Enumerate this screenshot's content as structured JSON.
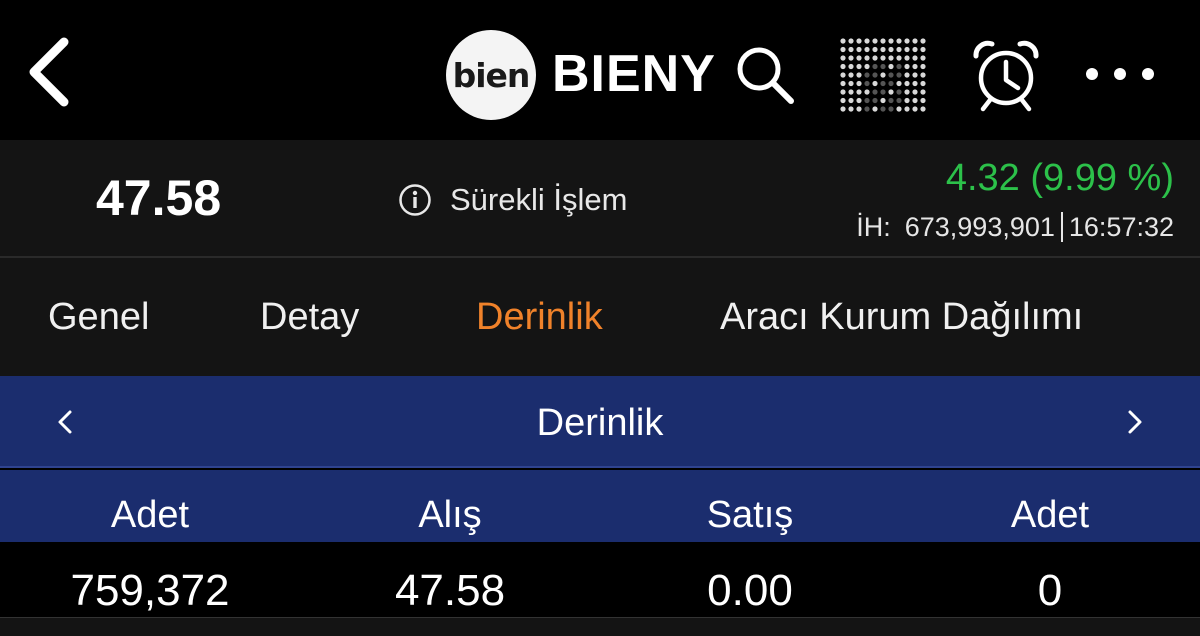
{
  "header": {
    "logo_text": "bien",
    "ticker": "BIENY",
    "icons": {
      "back": "chevron-left-icon",
      "search": "search-icon",
      "grid": "dot-grid-icon",
      "alarm": "alarm-clock-icon",
      "more": "more-dots-icon"
    }
  },
  "quote": {
    "price": "47.58",
    "status_label": "Sürekli İşlem",
    "change": "4.32 (9.99 %)",
    "volume_label": "İH:",
    "volume": "673,993,901",
    "time": "16:57:32",
    "change_color": "#2cc14a"
  },
  "tabs": [
    {
      "label": "Genel",
      "active": false
    },
    {
      "label": "Detay",
      "active": false
    },
    {
      "label": "Derinlik",
      "active": true
    },
    {
      "label": "Aracı Kurum Dağılımı",
      "active": false
    }
  ],
  "section": {
    "title": "Derinlik",
    "accent_color": "#1b2d6e"
  },
  "depth": {
    "columns": [
      "Adet",
      "Alış",
      "Satış",
      "Adet"
    ],
    "rows": [
      [
        "759,372",
        "47.58",
        "0.00",
        "0"
      ]
    ]
  },
  "colors": {
    "active_tab": "#f0822a"
  }
}
